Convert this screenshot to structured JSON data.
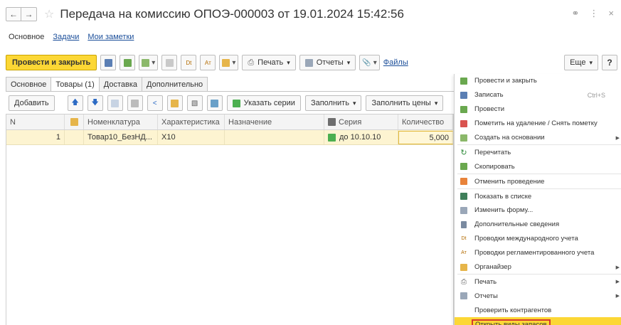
{
  "window": {
    "title": "Передача на комиссию ОПОЭ-000003 от 19.01.2024 15:42:56"
  },
  "main_nav": {
    "items": [
      {
        "label": "Основное",
        "active": true
      },
      {
        "label": "Задачи",
        "active": false
      },
      {
        "label": "Мои заметки",
        "active": false
      }
    ]
  },
  "toolbar": {
    "post_close_label": "Провести и закрыть",
    "print_label": "Печать",
    "reports_label": "Отчеты",
    "files_label": "Файлы",
    "more_label": "Еще",
    "help_label": "?"
  },
  "tabs": [
    {
      "label": "Основное",
      "active": false
    },
    {
      "label": "Товары (1)",
      "active": true
    },
    {
      "label": "Доставка",
      "active": false
    },
    {
      "label": "Дополнительно",
      "active": false
    }
  ],
  "table_toolbar": {
    "add_label": "Добавить",
    "series_label": "Указать серии",
    "fill_label": "Заполнить",
    "fill_prices_label": "Заполнить цены"
  },
  "table": {
    "columns": [
      "N",
      "",
      "Номенклатура",
      "Характеристика",
      "Назначение",
      "Серия",
      "Количество"
    ],
    "rows": [
      {
        "n": "1",
        "nomenclature": "Товар10_БезНД...",
        "characteristic": "X10",
        "purpose": "",
        "series": "до 10.10.10",
        "quantity": "5,000"
      }
    ]
  },
  "context_menu": {
    "items": [
      {
        "label": "Провести и закрыть",
        "icon": "post-close-icon",
        "shortcut": "",
        "submenu": false
      },
      {
        "label": "Записать",
        "icon": "save-icon",
        "shortcut": "Ctrl+S",
        "submenu": false
      },
      {
        "label": "Провести",
        "icon": "post-icon",
        "shortcut": "",
        "submenu": false
      },
      {
        "label": "Пометить на удаление / Снять пометку",
        "icon": "delete-mark-icon",
        "shortcut": "",
        "submenu": false
      },
      {
        "label": "Создать на основании",
        "icon": "create-based-icon",
        "shortcut": "",
        "submenu": true
      },
      {
        "label": "Перечитать",
        "icon": "reload-icon",
        "shortcut": "",
        "submenu": false
      },
      {
        "label": "Скопировать",
        "icon": "copy-icon",
        "shortcut": "",
        "submenu": false
      },
      {
        "label": "Отменить проведение",
        "icon": "unpost-icon",
        "shortcut": "",
        "submenu": false
      },
      {
        "label": "Показать в списке",
        "icon": "show-in-list-icon",
        "shortcut": "",
        "submenu": false
      },
      {
        "label": "Изменить форму...",
        "icon": "form-edit-icon",
        "shortcut": "",
        "submenu": false
      },
      {
        "label": "Дополнительные сведения",
        "icon": "additional-info-icon",
        "shortcut": "",
        "submenu": false
      },
      {
        "label": "Проводки международного учета",
        "icon": "intl-postings-icon",
        "shortcut": "",
        "submenu": false
      },
      {
        "label": "Проводки регламентированного учета",
        "icon": "reg-postings-icon",
        "shortcut": "",
        "submenu": false
      },
      {
        "label": "Органайзер",
        "icon": "organizer-icon",
        "shortcut": "",
        "submenu": true
      },
      {
        "label": "Печать",
        "icon": "print-icon",
        "shortcut": "",
        "submenu": true
      },
      {
        "label": "Отчеты",
        "icon": "reports-icon",
        "shortcut": "",
        "submenu": true
      },
      {
        "label": "Проверить контрагентов",
        "icon": "",
        "shortcut": "",
        "submenu": false
      },
      {
        "label": "Открыть виды запасов",
        "icon": "",
        "shortcut": "",
        "submenu": false,
        "highlighted": true
      }
    ]
  },
  "colors": {
    "accent_yellow": "#fcd735",
    "row_highlight": "#fdf4d1",
    "link_blue": "#1c4f9a",
    "highlight_border": "#d63b2f"
  }
}
